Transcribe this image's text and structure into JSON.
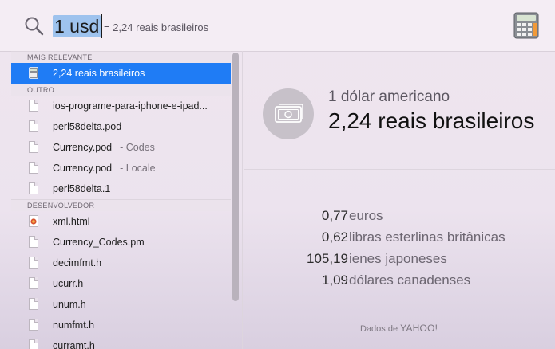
{
  "search": {
    "query": "1 usd",
    "hint": "= 2,24 reais brasileiros"
  },
  "icons": {
    "search": "search-icon",
    "calculator": "calculator-icon",
    "currency": "banknote-icon",
    "document": "document-icon",
    "html_file": "html-file-icon"
  },
  "list": {
    "sections": [
      {
        "title": "MAIS RELEVANTE",
        "items": [
          {
            "label": "2,24 reais brasileiros",
            "icon": "calculator-icon",
            "selected": true
          }
        ]
      },
      {
        "title": "OUTRO",
        "items": [
          {
            "label": "ios-programe-para-iphone-e-ipad...",
            "icon": "document-icon"
          },
          {
            "label": "perl58delta.pod",
            "icon": "document-icon"
          },
          {
            "label": "Currency.pod",
            "detail": "- Codes",
            "icon": "document-icon"
          },
          {
            "label": "Currency.pod",
            "detail": "- Locale",
            "icon": "document-icon"
          },
          {
            "label": "perl58delta.1",
            "icon": "document-icon"
          }
        ]
      },
      {
        "title": "DESENVOLVEDOR",
        "items": [
          {
            "label": "xml.html",
            "icon": "html-file-icon"
          },
          {
            "label": "Currency_Codes.pm",
            "icon": "document-icon"
          },
          {
            "label": "decimfmt.h",
            "icon": "document-icon"
          },
          {
            "label": "ucurr.h",
            "icon": "document-icon"
          },
          {
            "label": "unum.h",
            "icon": "document-icon"
          },
          {
            "label": "numfmt.h",
            "icon": "document-icon"
          },
          {
            "label": "curramt.h",
            "icon": "document-icon"
          }
        ]
      }
    ]
  },
  "detail": {
    "from": "1 dólar americano",
    "to": "2,24 reais brasileiros",
    "rates": [
      {
        "value": "0,77",
        "currency": "euros"
      },
      {
        "value": "0,62",
        "currency": "libras esterlinas britânicas"
      },
      {
        "value": "105,19",
        "currency": "ienes japoneses"
      },
      {
        "value": "1,09",
        "currency": "dólares canadenses"
      }
    ],
    "credit_prefix": "Dados de",
    "credit_brand": "YAHOO!"
  },
  "colors": {
    "selection": "#1f7cf5",
    "query_highlight": "#9ec3ee"
  }
}
